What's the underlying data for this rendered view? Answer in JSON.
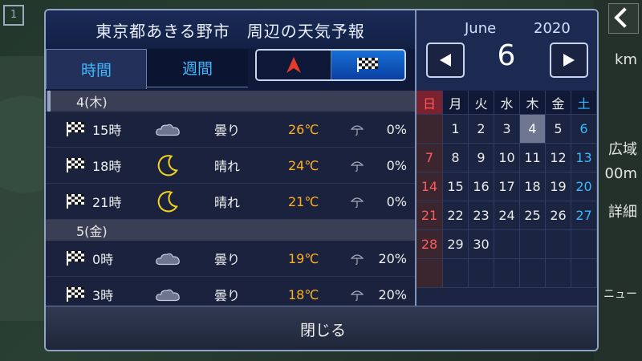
{
  "dialog": {
    "title": "東京都あきる野市　周辺の天気予報",
    "tabs": [
      {
        "label": "時間",
        "active": true
      },
      {
        "label": "週間",
        "active": false
      }
    ],
    "toggle": {
      "left_icon": "direction-arrow-icon",
      "right_icon": "checkered-flag-icon",
      "selected": "right"
    },
    "close_label": "閉じる"
  },
  "forecast": [
    {
      "day": "4(木)",
      "rows": [
        {
          "icon": "checkered-flag-icon",
          "hour": "15時",
          "weather_icon": "cloud-icon",
          "condition": "曇り",
          "temp": "26℃",
          "rain": "0%"
        },
        {
          "icon": "checkered-flag-icon",
          "hour": "18時",
          "weather_icon": "moon-icon",
          "condition": "晴れ",
          "temp": "24℃",
          "rain": "0%"
        },
        {
          "icon": "checkered-flag-icon",
          "hour": "21時",
          "weather_icon": "moon-icon",
          "condition": "晴れ",
          "temp": "21℃",
          "rain": "0%"
        }
      ]
    },
    {
      "day": "5(金)",
      "rows": [
        {
          "icon": "checkered-flag-icon",
          "hour": "0時",
          "weather_icon": "cloud-icon",
          "condition": "曇り",
          "temp": "19℃",
          "rain": "20%"
        },
        {
          "icon": "checkered-flag-icon",
          "hour": "3時",
          "weather_icon": "cloud-icon",
          "condition": "曇り",
          "temp": "18℃",
          "rain": "20%"
        }
      ]
    }
  ],
  "calendar": {
    "month": "June",
    "year": "2020",
    "day": "6",
    "weekdays": [
      "日",
      "月",
      "火",
      "水",
      "木",
      "金",
      "土"
    ],
    "weeks": [
      [
        "",
        "1",
        "2",
        "3",
        "4",
        "5",
        "6"
      ],
      [
        "7",
        "8",
        "9",
        "10",
        "11",
        "12",
        "13"
      ],
      [
        "14",
        "15",
        "16",
        "17",
        "18",
        "19",
        "20"
      ],
      [
        "21",
        "22",
        "23",
        "24",
        "25",
        "26",
        "27"
      ],
      [
        "28",
        "29",
        "30",
        "",
        "",
        "",
        ""
      ],
      [
        "",
        "",
        "",
        "",
        "",
        "",
        ""
      ]
    ],
    "today": "4"
  },
  "background": {
    "right_texts": [
      "km",
      "広域",
      "00m",
      "詳細",
      "ニュー"
    ]
  },
  "colors": {
    "temp": "#ffb020",
    "tab_text": "#3fb8ff",
    "sunday": "#ff5b5b",
    "saturday": "#3ab8ff",
    "dialog_bg": "#0f1a3a"
  }
}
